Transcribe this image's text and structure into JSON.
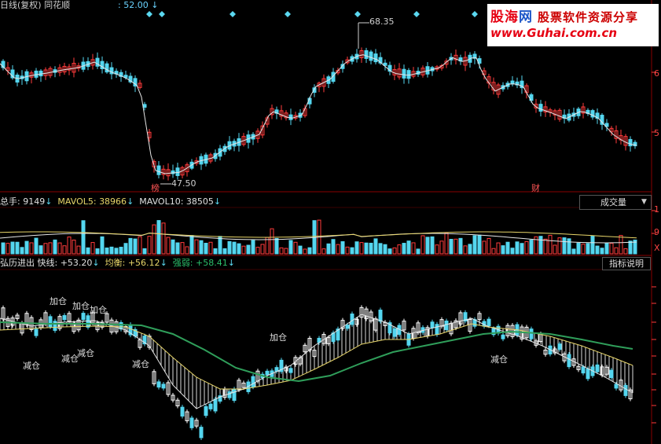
{
  "header": {
    "title": "日线(复权) 同花顺",
    "price_label": ": 52.00",
    "price_arrow": "↓"
  },
  "logo": {
    "name_part1": "股海",
    "name_part2": "网",
    "slogan": "股票软件资源分享",
    "url": "www.Guhai.com.cn"
  },
  "price_chart": {
    "high_label": "68.35",
    "low_label": "47.50",
    "tag_left": "榜",
    "tag_right": "财",
    "axis_labels": [
      "6",
      "5"
    ]
  },
  "volume": {
    "label": "总手: ",
    "value": "9149",
    "mavol5_label": "MAVOL5: ",
    "mavol5_value": "38966",
    "mavol10_label": "MAVOL10: ",
    "mavol10_value": "38505",
    "arrow": "↓",
    "selector": "成交量",
    "axis_labels": [
      "1",
      "9",
      "X"
    ]
  },
  "indicator": {
    "name": "弘历进出",
    "fast_label": "快线: ",
    "fast_value": "+53.20",
    "mid_label": "均衡: ",
    "mid_value": "+56.12",
    "strong_label": "强弱: ",
    "strong_value": "+58.41",
    "arrow": "↓",
    "help_button": "指标说明",
    "signals": {
      "add": "加仓",
      "reduce": "减仓"
    }
  },
  "colors": {
    "up": "#ff3b3b",
    "down": "#54d6ef",
    "ma_white": "#e6e6e6",
    "ma_yellow": "#e8d66a",
    "ma_green": "#2f9e5a",
    "grid": "#7a0000"
  }
}
